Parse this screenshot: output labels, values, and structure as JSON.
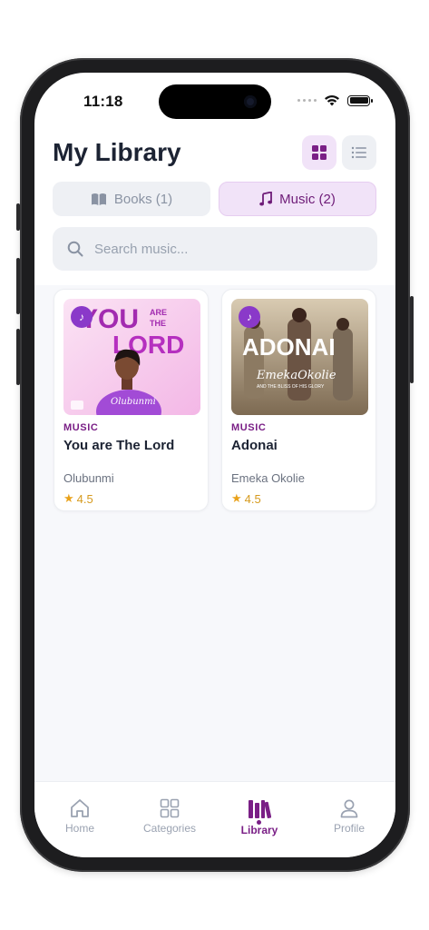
{
  "status": {
    "time": "11:18"
  },
  "header": {
    "title": "My Library"
  },
  "tabs": [
    {
      "label": "Books (1)",
      "active": false,
      "icon": "book-icon"
    },
    {
      "label": "Music (2)",
      "active": true,
      "icon": "music-note-icon"
    }
  ],
  "search": {
    "placeholder": "Search music...",
    "value": ""
  },
  "items": [
    {
      "category": "MUSIC",
      "title": "You are The Lord",
      "author": "Olubunmi",
      "rating": "4.5",
      "cover_text_top": "YOU",
      "cover_text_mid": "ARE THE",
      "cover_text_big": "LORD",
      "cover_signature": "Olubunmi"
    },
    {
      "category": "MUSIC",
      "title": "Adonai",
      "author": "Emeka Okolie",
      "rating": "4.5",
      "cover_text_big": "ADONAI",
      "cover_signature": "EmekaOkolie",
      "cover_subtitle": "AND THE BLISS OF HIS GLORY"
    }
  ],
  "nav": [
    {
      "label": "Home",
      "icon": "home-icon"
    },
    {
      "label": "Categories",
      "icon": "grid-icon"
    },
    {
      "label": "Library",
      "icon": "library-icon",
      "active": true
    },
    {
      "label": "Profile",
      "icon": "user-icon"
    }
  ],
  "colors": {
    "accent": "#7a1f86",
    "accent_bg": "#f1e3f8",
    "rating": "#e9a21b"
  }
}
